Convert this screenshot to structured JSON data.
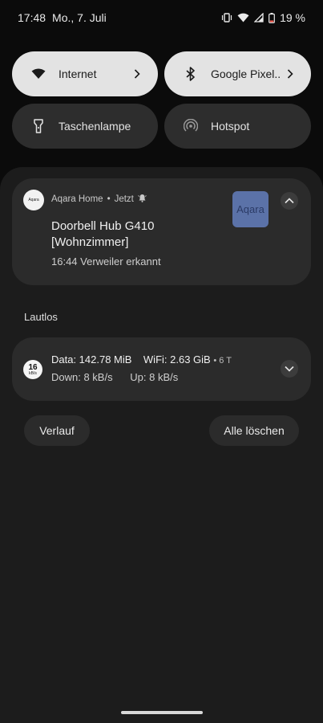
{
  "status_bar": {
    "time": "17:48",
    "date": "Mo., 7. Juli",
    "battery_text": "19 %",
    "icons": [
      "vibrate-icon",
      "wifi-icon",
      "cell-signal-icon",
      "battery-icon"
    ]
  },
  "quick_settings": {
    "tiles": [
      {
        "label": "Internet",
        "icon": "wifi-icon",
        "active": true,
        "has_chevron": true
      },
      {
        "label": "Google Pixel..",
        "icon": "bluetooth-icon",
        "active": true,
        "has_chevron": true
      },
      {
        "label": "Taschenlampe",
        "icon": "flashlight-icon",
        "active": false,
        "has_chevron": false
      },
      {
        "label": "Hotspot",
        "icon": "hotspot-icon",
        "active": false,
        "has_chevron": false
      }
    ]
  },
  "notification": {
    "app_icon_text": "Aqara",
    "app_name": "Aqara Home",
    "separator": "•",
    "time": "Jetzt",
    "title": "Doorbell Hub G410 [Wohnzimmer]",
    "body": "16:44 Verweiler erkannt",
    "large_icon_text": "Aqara",
    "large_icon_color": "#5b72a8"
  },
  "silent_section": {
    "label": "Lautlos"
  },
  "data_notification": {
    "icon_value": "16",
    "icon_unit": "kB/s",
    "data_label": "Data: 142.78 MiB",
    "wifi_label": "WiFi: 2.63 GiB",
    "age": "• 6 T",
    "down": "Down: 8 kB/s",
    "up": "Up: 8 kB/s"
  },
  "footer": {
    "history_button": "Verlauf",
    "clear_all_button": "Alle löschen"
  },
  "colors": {
    "background": "#0b0b0b",
    "shade": "#1c1c1c",
    "card": "#2b2b2b",
    "tile_active": "#e3e3e3",
    "tile_inactive": "#2d2d2d"
  }
}
